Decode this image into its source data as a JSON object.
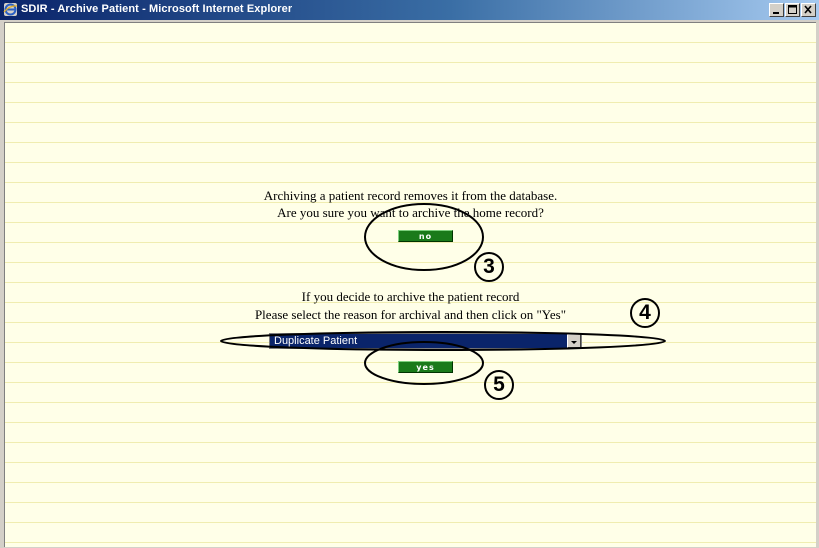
{
  "window": {
    "title": "SDIR - Archive Patient - Microsoft Internet Explorer",
    "icon": "ie-logo-icon",
    "controls": [
      "minimize-icon",
      "maximize-icon",
      "close-icon"
    ]
  },
  "archive": {
    "line1": "Archiving a patient record removes it from the database.",
    "line2": "Are you sure you want to archive the home record?",
    "no_label": "no"
  },
  "reason": {
    "line1": "If you decide to archive the patient record",
    "line2": "Please select the reason for archival and then click on \"Yes\"",
    "selected": "Duplicate Patient",
    "yes_label": "yes"
  },
  "callouts": {
    "c3": "3",
    "c4": "4",
    "c5": "5"
  },
  "colors": {
    "page_bg": "#ffffe8",
    "button_green": "#1a7a1a",
    "select_bg": "#0a246a",
    "titlebar": "#0a246a"
  }
}
